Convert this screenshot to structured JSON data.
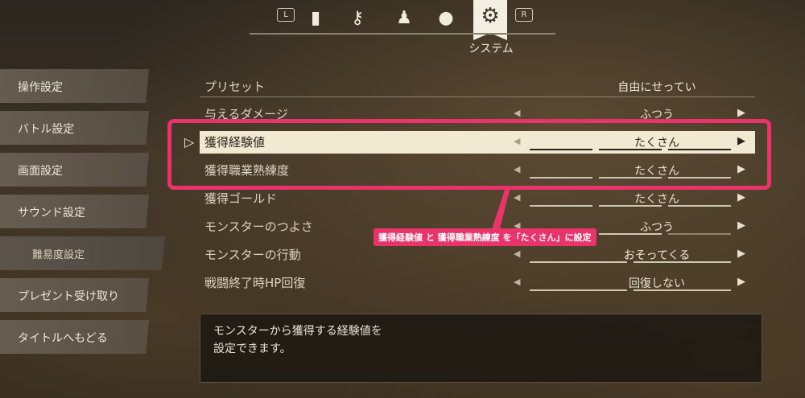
{
  "topbar": {
    "left_key": "L",
    "right_key": "R",
    "active_label": "システム",
    "icons": [
      "book-icon",
      "key-icon",
      "party-icon",
      "bag-icon",
      "gear-icon"
    ]
  },
  "sidebar": {
    "items": [
      {
        "label": "操作設定"
      },
      {
        "label": "バトル設定"
      },
      {
        "label": "画面設定"
      },
      {
        "label": "サウンド設定"
      },
      {
        "label": "難易度設定"
      },
      {
        "label": "プレゼント受け取り"
      },
      {
        "label": "タイトルへもどる"
      }
    ]
  },
  "settings": {
    "preset": {
      "label": "プリセット",
      "value": "自由にせってい"
    },
    "rows": [
      {
        "label": "与えるダメージ",
        "value": "ふつう",
        "level": 2
      },
      {
        "label": "獲得経験値",
        "value": "たくさん",
        "level": 3
      },
      {
        "label": "獲得職業熟練度",
        "value": "たくさん",
        "level": 3
      },
      {
        "label": "獲得ゴールド",
        "value": "たくさん",
        "level": 3
      },
      {
        "label": "モンスターのつよさ",
        "value": "ふつう",
        "level": 2
      },
      {
        "label": "モンスターの行動",
        "value": "おそってくる",
        "level": 2
      },
      {
        "label": "戦闘終了時HP回復",
        "value": "回復しない",
        "level": 2
      }
    ]
  },
  "callout": {
    "text": "獲得経験値 と 獲得職業熟練度 を「たくさん」に設定"
  },
  "description": {
    "line1": "モンスターから獲得する経験値を",
    "line2": "設定できます。"
  },
  "colors": {
    "accent": "#e8336b",
    "selected_row": "#f2e9d2"
  }
}
